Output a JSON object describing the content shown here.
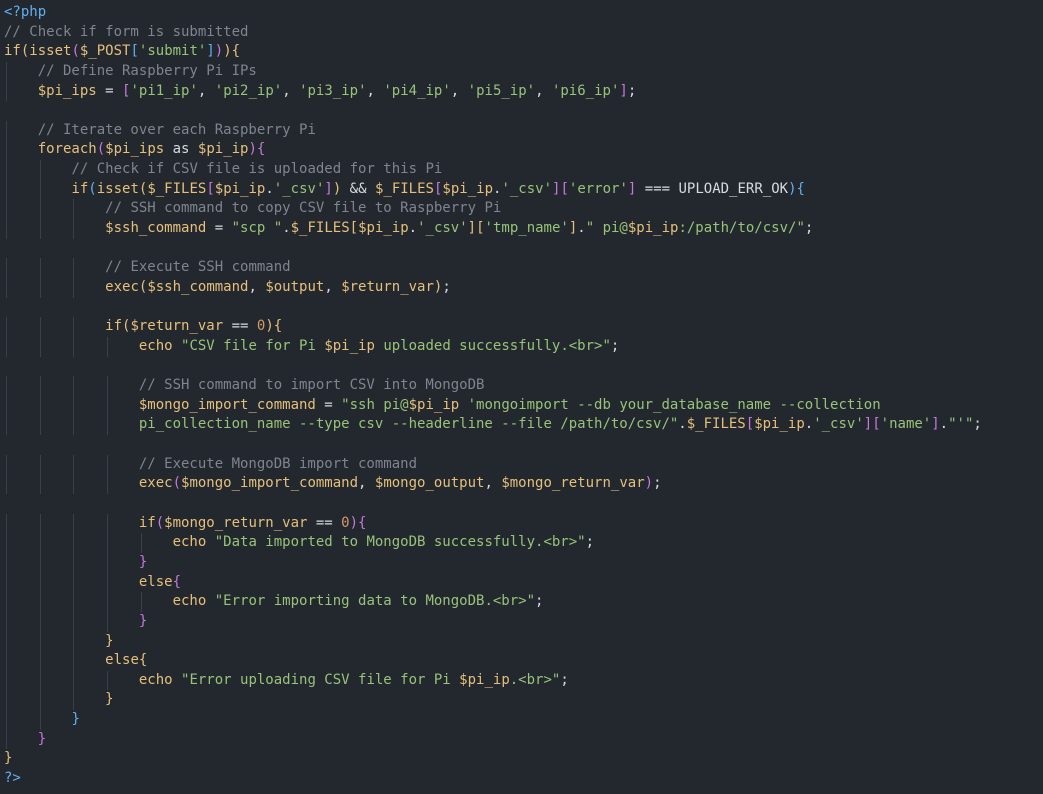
{
  "editor": {
    "language": "php",
    "lines": [
      [
        [
          "tag",
          "<?php"
        ]
      ],
      [
        [
          "cmt",
          "// Check if form is submitted"
        ]
      ],
      [
        [
          "kw",
          "if"
        ],
        [
          "brc3",
          "("
        ],
        [
          "fn",
          "isset"
        ],
        [
          "brc",
          "("
        ],
        [
          "var",
          "$_POST"
        ],
        [
          "brc2",
          "["
        ],
        [
          "str",
          "'submit'"
        ],
        [
          "brc2",
          "]"
        ],
        [
          "brc",
          ")"
        ],
        [
          "brc3",
          ")"
        ],
        [
          "brc3",
          "{"
        ]
      ],
      [
        [
          "txt",
          "    "
        ],
        [
          "cmt",
          "// Define Raspberry Pi IPs"
        ]
      ],
      [
        [
          "txt",
          "    "
        ],
        [
          "var",
          "$pi_ips"
        ],
        [
          "txt",
          " = "
        ],
        [
          "brc",
          "["
        ],
        [
          "str",
          "'pi1_ip'"
        ],
        [
          "txt",
          ", "
        ],
        [
          "str",
          "'pi2_ip'"
        ],
        [
          "txt",
          ", "
        ],
        [
          "str",
          "'pi3_ip'"
        ],
        [
          "txt",
          ", "
        ],
        [
          "str",
          "'pi4_ip'"
        ],
        [
          "txt",
          ", "
        ],
        [
          "str",
          "'pi5_ip'"
        ],
        [
          "txt",
          ", "
        ],
        [
          "str",
          "'pi6_ip'"
        ],
        [
          "brc",
          "]"
        ],
        [
          "txt",
          ";"
        ]
      ],
      [],
      [
        [
          "txt",
          "    "
        ],
        [
          "cmt",
          "// Iterate over each Raspberry Pi"
        ]
      ],
      [
        [
          "txt",
          "    "
        ],
        [
          "kw",
          "foreach"
        ],
        [
          "brc",
          "("
        ],
        [
          "var",
          "$pi_ips"
        ],
        [
          "txt",
          " as "
        ],
        [
          "var",
          "$pi_ip"
        ],
        [
          "brc",
          ")"
        ],
        [
          "brc",
          "{"
        ]
      ],
      [
        [
          "txt",
          "        "
        ],
        [
          "cmt",
          "// Check if CSV file is uploaded for this Pi"
        ]
      ],
      [
        [
          "txt",
          "        "
        ],
        [
          "kw",
          "if"
        ],
        [
          "brc2",
          "("
        ],
        [
          "fn",
          "isset"
        ],
        [
          "brc3",
          "("
        ],
        [
          "var",
          "$_FILES"
        ],
        [
          "brc",
          "["
        ],
        [
          "var",
          "$pi_ip"
        ],
        [
          "txt",
          "."
        ],
        [
          "str",
          "'_csv'"
        ],
        [
          "brc",
          "]"
        ],
        [
          "brc3",
          ")"
        ],
        [
          "txt",
          " && "
        ],
        [
          "var",
          "$_FILES"
        ],
        [
          "brc",
          "["
        ],
        [
          "var",
          "$pi_ip"
        ],
        [
          "txt",
          "."
        ],
        [
          "str",
          "'_csv'"
        ],
        [
          "brc",
          "]"
        ],
        [
          "brc",
          "["
        ],
        [
          "str",
          "'error'"
        ],
        [
          "brc",
          "]"
        ],
        [
          "txt",
          " === UPLOAD_ERR_OK"
        ],
        [
          "brc2",
          ")"
        ],
        [
          "brc2",
          "{"
        ]
      ],
      [
        [
          "txt",
          "            "
        ],
        [
          "cmt",
          "// SSH command to copy CSV file to Raspberry Pi"
        ]
      ],
      [
        [
          "txt",
          "            "
        ],
        [
          "var",
          "$ssh_command"
        ],
        [
          "txt",
          " = "
        ],
        [
          "strd",
          "\"scp \""
        ],
        [
          "txt",
          "."
        ],
        [
          "var",
          "$_FILES"
        ],
        [
          "brc3",
          "["
        ],
        [
          "var",
          "$pi_ip"
        ],
        [
          "txt",
          "."
        ],
        [
          "str",
          "'_csv'"
        ],
        [
          "brc3",
          "]"
        ],
        [
          "brc3",
          "["
        ],
        [
          "str",
          "'tmp_name'"
        ],
        [
          "brc3",
          "]"
        ],
        [
          "txt",
          "."
        ],
        [
          "strd",
          "\" pi@"
        ],
        [
          "var",
          "$pi_ip"
        ],
        [
          "strd",
          ":/path/to/csv/\""
        ],
        [
          "txt",
          ";"
        ]
      ],
      [],
      [
        [
          "txt",
          "            "
        ],
        [
          "cmt",
          "// Execute SSH command"
        ]
      ],
      [
        [
          "txt",
          "            "
        ],
        [
          "fn",
          "exec"
        ],
        [
          "brc3",
          "("
        ],
        [
          "var",
          "$ssh_command"
        ],
        [
          "txt",
          ", "
        ],
        [
          "var",
          "$output"
        ],
        [
          "txt",
          ", "
        ],
        [
          "var",
          "$return_var"
        ],
        [
          "brc3",
          ")"
        ],
        [
          "txt",
          ";"
        ]
      ],
      [],
      [
        [
          "txt",
          "            "
        ],
        [
          "kw",
          "if"
        ],
        [
          "brc3",
          "("
        ],
        [
          "var",
          "$return_var"
        ],
        [
          "txt",
          " == "
        ],
        [
          "num",
          "0"
        ],
        [
          "brc3",
          ")"
        ],
        [
          "brc3",
          "{"
        ]
      ],
      [
        [
          "txt",
          "                "
        ],
        [
          "fn",
          "echo"
        ],
        [
          "txt",
          " "
        ],
        [
          "strd",
          "\"CSV file for Pi "
        ],
        [
          "var",
          "$pi_ip"
        ],
        [
          "strd",
          " uploaded successfully.<br>\""
        ],
        [
          "txt",
          ";"
        ]
      ],
      [],
      [
        [
          "txt",
          "                "
        ],
        [
          "cmt",
          "// SSH command to import CSV into MongoDB"
        ]
      ],
      [
        [
          "txt",
          "                "
        ],
        [
          "var",
          "$mongo_import_command"
        ],
        [
          "txt",
          " = "
        ],
        [
          "strd",
          "\"ssh pi@"
        ],
        [
          "var",
          "$pi_ip"
        ],
        [
          "strd",
          " 'mongoimport --db your_database_name --collection"
        ]
      ],
      [
        [
          "txt",
          "                "
        ],
        [
          "strd",
          "pi_collection_name --type csv --headerline --file /path/to/csv/\""
        ],
        [
          "txt",
          "."
        ],
        [
          "var",
          "$_FILES"
        ],
        [
          "brc",
          "["
        ],
        [
          "var",
          "$pi_ip"
        ],
        [
          "txt",
          "."
        ],
        [
          "str",
          "'_csv'"
        ],
        [
          "brc",
          "]"
        ],
        [
          "brc",
          "["
        ],
        [
          "str",
          "'name'"
        ],
        [
          "brc",
          "]"
        ],
        [
          "txt",
          "."
        ],
        [
          "strd",
          "\"'\""
        ],
        [
          "txt",
          ";"
        ]
      ],
      [],
      [
        [
          "txt",
          "                "
        ],
        [
          "cmt",
          "// Execute MongoDB import command"
        ]
      ],
      [
        [
          "txt",
          "                "
        ],
        [
          "fn",
          "exec"
        ],
        [
          "brc",
          "("
        ],
        [
          "var",
          "$mongo_import_command"
        ],
        [
          "txt",
          ", "
        ],
        [
          "var",
          "$mongo_output"
        ],
        [
          "txt",
          ", "
        ],
        [
          "var",
          "$mongo_return_var"
        ],
        [
          "brc",
          ")"
        ],
        [
          "txt",
          ";"
        ]
      ],
      [],
      [
        [
          "txt",
          "                "
        ],
        [
          "kw",
          "if"
        ],
        [
          "brc",
          "("
        ],
        [
          "var",
          "$mongo_return_var"
        ],
        [
          "txt",
          " == "
        ],
        [
          "num",
          "0"
        ],
        [
          "brc",
          ")"
        ],
        [
          "brc",
          "{"
        ]
      ],
      [
        [
          "txt",
          "                    "
        ],
        [
          "fn",
          "echo"
        ],
        [
          "txt",
          " "
        ],
        [
          "strd",
          "\"Data imported to MongoDB successfully.<br>\""
        ],
        [
          "txt",
          ";"
        ]
      ],
      [
        [
          "txt",
          "                "
        ],
        [
          "brc",
          "}"
        ]
      ],
      [
        [
          "txt",
          "                "
        ],
        [
          "kw",
          "else"
        ],
        [
          "brc",
          "{"
        ]
      ],
      [
        [
          "txt",
          "                    "
        ],
        [
          "fn",
          "echo"
        ],
        [
          "txt",
          " "
        ],
        [
          "strd",
          "\"Error importing data to MongoDB.<br>\""
        ],
        [
          "txt",
          ";"
        ]
      ],
      [
        [
          "txt",
          "                "
        ],
        [
          "brc",
          "}"
        ]
      ],
      [
        [
          "txt",
          "            "
        ],
        [
          "brc3",
          "}"
        ]
      ],
      [
        [
          "txt",
          "            "
        ],
        [
          "kw",
          "else"
        ],
        [
          "brc3",
          "{"
        ]
      ],
      [
        [
          "txt",
          "                "
        ],
        [
          "fn",
          "echo"
        ],
        [
          "txt",
          " "
        ],
        [
          "strd",
          "\"Error uploading CSV file for Pi "
        ],
        [
          "var",
          "$pi_ip"
        ],
        [
          "strd",
          ".<br>\""
        ],
        [
          "txt",
          ";"
        ]
      ],
      [
        [
          "txt",
          "            "
        ],
        [
          "brc3",
          "}"
        ]
      ],
      [
        [
          "txt",
          "        "
        ],
        [
          "brc2",
          "}"
        ]
      ],
      [
        [
          "txt",
          "    "
        ],
        [
          "brc",
          "}"
        ]
      ],
      [
        [
          "brc3",
          "}"
        ]
      ],
      [
        [
          "tag",
          "?>"
        ]
      ]
    ]
  }
}
